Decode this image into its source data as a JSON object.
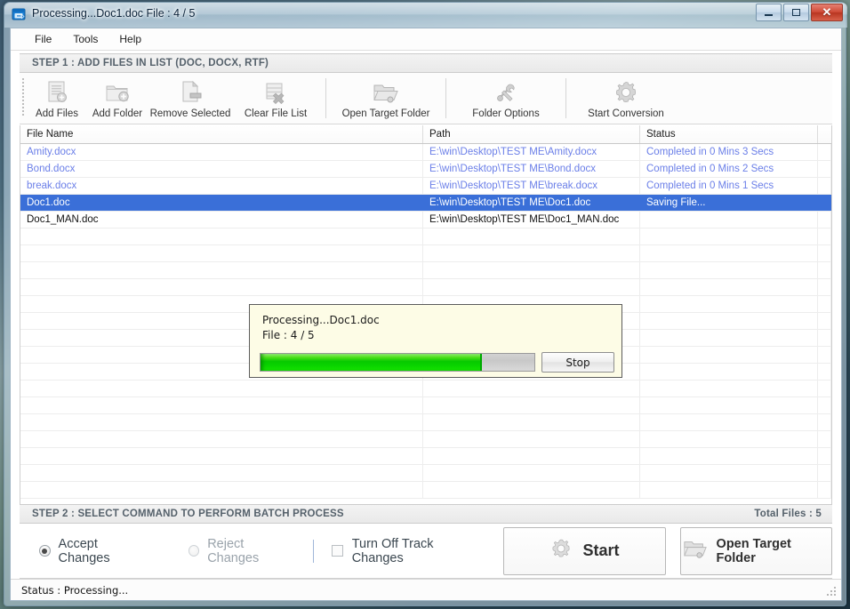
{
  "window": {
    "title": "Processing...Doc1.doc File : 4 / 5",
    "icon": "app-window-icon",
    "minimize_label": "Minimize",
    "maximize_label": "Maximize",
    "close_label": "Close",
    "close_glyph": "✕"
  },
  "menubar": {
    "items": [
      {
        "label": "File",
        "name": "menu-file"
      },
      {
        "label": "Tools",
        "name": "menu-tools"
      },
      {
        "label": "Help",
        "name": "menu-help"
      }
    ]
  },
  "step1": {
    "header": "STEP 1 : ADD FILES IN LIST (DOC, DOCX, RTF)"
  },
  "toolbar": {
    "buttons": [
      {
        "label": "Add Files",
        "icon": "add-file-icon"
      },
      {
        "label": "Add Folder",
        "icon": "add-folder-icon"
      },
      {
        "label": "Remove Selected",
        "icon": "remove-file-icon"
      },
      {
        "label": "Clear File List",
        "icon": "clear-list-icon"
      },
      {
        "label": "Open Target Folder",
        "icon": "open-folder-icon"
      },
      {
        "label": "Folder Options",
        "icon": "tools-wrench-icon"
      },
      {
        "label": "Start Conversion",
        "icon": "gear-icon"
      }
    ]
  },
  "grid": {
    "columns": [
      "File Name",
      "Path",
      "Status",
      ""
    ],
    "rows": [
      {
        "file_name": "Amity.docx",
        "path": "E:\\win\\Desktop\\TEST ME\\Amity.docx",
        "status": "Completed in 0 Mins 3 Secs",
        "style": "link",
        "selected": false
      },
      {
        "file_name": "Bond.docx",
        "path": "E:\\win\\Desktop\\TEST ME\\Bond.docx",
        "status": "Completed in 0 Mins 2 Secs",
        "style": "link",
        "selected": false
      },
      {
        "file_name": "break.docx",
        "path": "E:\\win\\Desktop\\TEST ME\\break.docx",
        "status": "Completed in 0 Mins 1 Secs",
        "style": "link",
        "selected": false
      },
      {
        "file_name": "Doc1.doc",
        "path": "E:\\win\\Desktop\\TEST ME\\Doc1.doc",
        "status": "Saving File...",
        "style": "link",
        "selected": true
      },
      {
        "file_name": "Doc1_MAN.doc",
        "path": "E:\\win\\Desktop\\TEST ME\\Doc1_MAN.doc",
        "status": "",
        "style": "plain",
        "selected": false
      }
    ],
    "empty_row_count": 16
  },
  "progress_dialog": {
    "line1": "Processing...Doc1.doc",
    "line2": "File : 4 / 5",
    "progress_percent": 81,
    "stop_label": "Stop"
  },
  "step2": {
    "header": "STEP 2 : SELECT COMMAND TO PERFORM BATCH PROCESS",
    "total_files": "Total Files : 5"
  },
  "commands": {
    "accept_changes": {
      "label": "Accept Changes",
      "selected": true
    },
    "reject_changes": {
      "label": "Reject Changes",
      "selected": false
    },
    "turn_off_track_changes": {
      "label": "Turn Off Track Changes",
      "checked": false
    },
    "start": {
      "label": "Start",
      "icon": "gear-icon"
    },
    "open_target_folder": {
      "label": "Open Target Folder",
      "icon": "open-folder-icon"
    }
  },
  "statusbar": {
    "text": "Status :  Processing..."
  },
  "colors": {
    "selection": "#3a6fd8",
    "link_text": "#6b7fe8",
    "progress_green": "#07c900",
    "step_header_text": "#55616b",
    "dialog_bg": "#fdfce6"
  }
}
